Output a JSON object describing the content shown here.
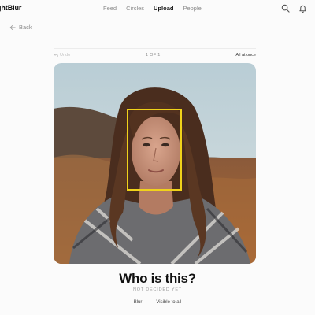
{
  "app": {
    "brand": "ghtBlur"
  },
  "nav": [
    {
      "label": "Feed",
      "active": false
    },
    {
      "label": "Circles",
      "active": false
    },
    {
      "label": "Upload",
      "active": true
    },
    {
      "label": "People",
      "active": false
    }
  ],
  "header_icons": [
    "search-icon",
    "bell-icon"
  ],
  "back": {
    "label": "Back",
    "icon": "arrow-left-icon"
  },
  "toolbar": {
    "undo_label": "Undo",
    "counter": "1 OF 1",
    "all_at_once": "All at once"
  },
  "photo": {
    "subject": "portrait-photo"
  },
  "face_detection": {
    "color": "#f0d21a"
  },
  "prompt": {
    "question": "Who is this?",
    "status": "NOT DECIDED YET"
  },
  "actions": {
    "blur_label": "Blur",
    "visible_label": "Visible to all"
  }
}
